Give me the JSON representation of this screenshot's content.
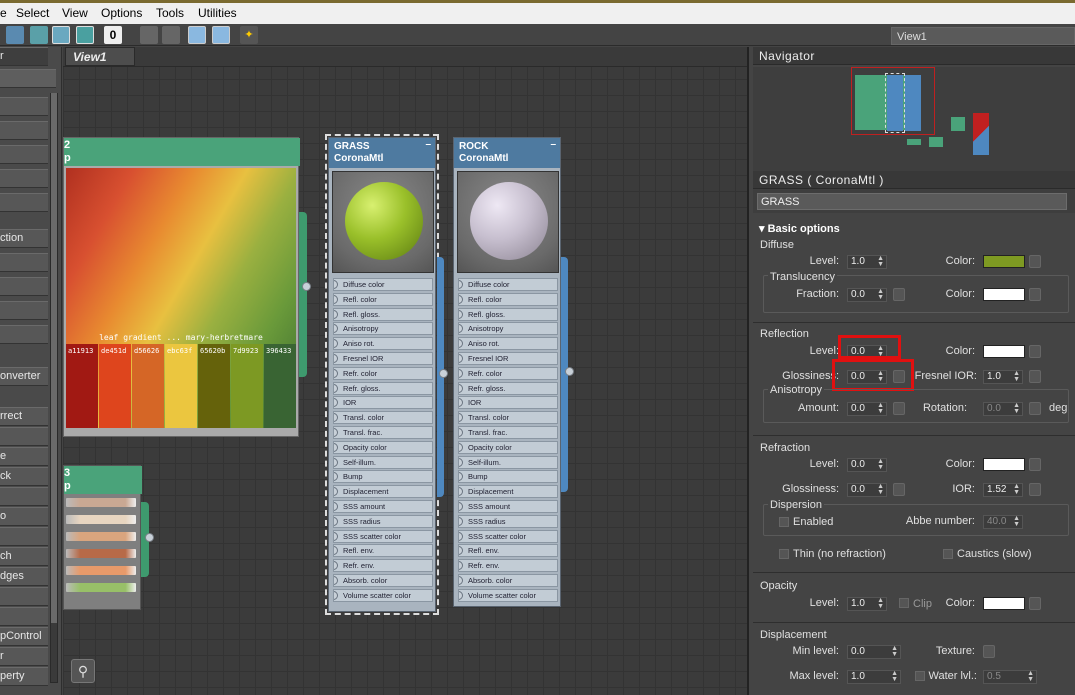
{
  "menu": [
    "e",
    "Select",
    "View",
    "Options",
    "Tools",
    "Utilities"
  ],
  "toolbar": {
    "zero_label": "0",
    "view_tab": "View1"
  },
  "left_panel": {
    "items": [
      "r",
      "",
      "",
      "",
      "",
      "",
      "ction",
      "",
      "",
      "",
      "",
      "onverter",
      "rrect",
      "",
      "e",
      "ck",
      "",
      "o",
      "",
      "ch",
      "dges",
      "",
      "",
      "pControl",
      "r",
      "perty"
    ]
  },
  "graph": {
    "tab": "View1",
    "bitmap_node": {
      "title_line1": "2",
      "title_line2": "p",
      "caption": "leaf gradient ... mary-herbretmare",
      "swatches": [
        {
          "code": "a11913",
          "color": "#a11913"
        },
        {
          "code": "de451d",
          "color": "#de451d"
        },
        {
          "code": "d56626",
          "color": "#d56626"
        },
        {
          "code": "ebc63f",
          "color": "#ebc63f"
        },
        {
          "code": "65620b",
          "color": "#65620b"
        },
        {
          "code": "7d9923",
          "color": "#7d9923"
        },
        {
          "code": "396433",
          "color": "#396433"
        }
      ]
    },
    "small_node": {
      "title_line1": "3",
      "title_line2": "p",
      "row_colors": [
        "#c9a893",
        "#e7d5c0",
        "#d9a57e",
        "#b76a48",
        "#e89a6a",
        "#98c068"
      ]
    },
    "grass_node": {
      "name": "GRASS",
      "type": "CoronaMtl",
      "minimize": "–",
      "sphere_color": "#9ac02a"
    },
    "rock_node": {
      "name": "ROCK",
      "type": "CoronaMtl",
      "minimize": "–",
      "sphere_color": "#c7bfcf"
    },
    "slots": [
      "Diffuse color",
      "Refl. color",
      "Refl. gloss.",
      "Anisotropy",
      "Aniso rot.",
      "Fresnel IOR",
      "Refr. color",
      "Refr. gloss.",
      "IOR",
      "Transl. color",
      "Transl. frac.",
      "Opacity color",
      "Self-illum.",
      "Bump",
      "Displacement",
      "SSS amount",
      "SSS radius",
      "SSS scatter color",
      "Refl. env.",
      "Refr. env.",
      "Absorb. color",
      "Volume scatter color"
    ]
  },
  "navigator": {
    "title": "Navigator"
  },
  "properties": {
    "title": "GRASS  ( CoronaMtl )",
    "name_value": "GRASS",
    "basic_options": "Basic options",
    "diffuse": {
      "header": "Diffuse",
      "level_label": "Level:",
      "level": "1.0",
      "color_label": "Color:",
      "color": "#7e9a22",
      "translucency": "Translucency",
      "fraction_label": "Fraction:",
      "fraction": "0.0",
      "transl_color_label": "Color:",
      "transl_color": "#ffffff"
    },
    "reflection": {
      "header": "Reflection",
      "level_label": "Level:",
      "level": "0.0",
      "color_label": "Color:",
      "color": "#ffffff",
      "gloss_label": "Glossiness:",
      "gloss": "0.0",
      "fresnel_label": "Fresnel IOR:",
      "fresnel": "1.0",
      "anisotropy": "Anisotropy",
      "amount_label": "Amount:",
      "amount": "0.0",
      "rotation_label": "Rotation:",
      "rotation": "0.0",
      "deg": "deg"
    },
    "refraction": {
      "header": "Refraction",
      "level_label": "Level:",
      "level": "0.0",
      "color_label": "Color:",
      "color": "#ffffff",
      "gloss_label": "Glossiness:",
      "gloss": "0.0",
      "ior_label": "IOR:",
      "ior": "1.52",
      "dispersion": "Dispersion",
      "enabled": "Enabled",
      "abbe_label": "Abbe number:",
      "abbe": "40.0",
      "thin": "Thin (no refraction)",
      "caustics": "Caustics (slow)"
    },
    "opacity": {
      "header": "Opacity",
      "level_label": "Level:",
      "level": "1.0",
      "clip": "Clip",
      "color_label": "Color:",
      "color": "#ffffff"
    },
    "displacement": {
      "header": "Displacement",
      "min_label": "Min level:",
      "min": "0.0",
      "texture_label": "Texture:",
      "max_label": "Max level:",
      "max": "1.0",
      "water_label": "Water lvl.:",
      "water": "0.5"
    }
  }
}
